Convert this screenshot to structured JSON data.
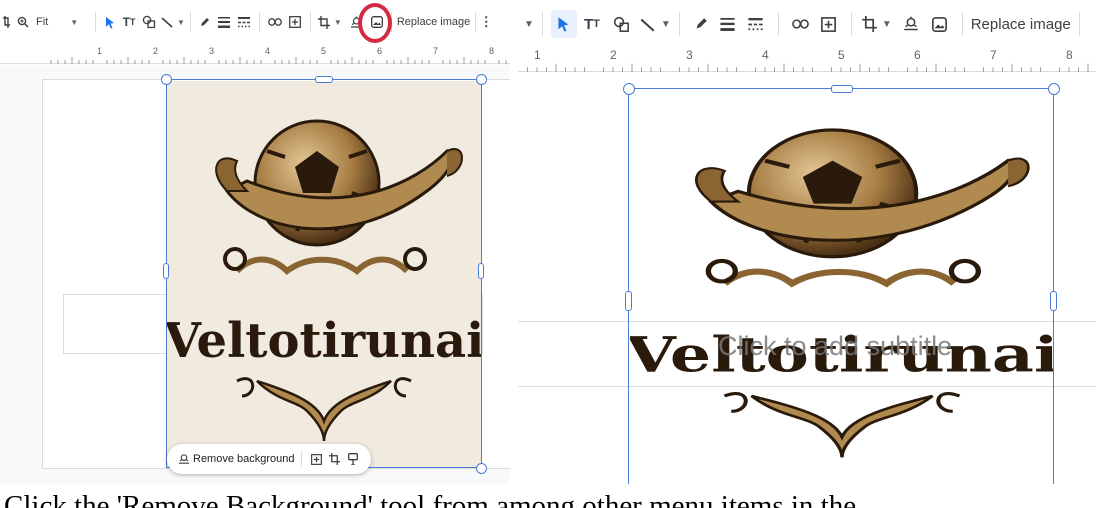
{
  "left_toolbar": {
    "zoom_label": "Fit",
    "replace_image_label": "Replace image"
  },
  "right_toolbar": {
    "replace_image_label": "Replace image"
  },
  "left_ruler": {
    "numbers": [
      "1",
      "2",
      "3",
      "4",
      "5",
      "6",
      "7",
      "8"
    ]
  },
  "right_ruler": {
    "numbers": [
      "1",
      "2",
      "3",
      "4",
      "5",
      "6",
      "7",
      "8"
    ]
  },
  "image": {
    "logo_text": "Veltotirunai"
  },
  "floating_toolbar": {
    "remove_background_label": "Remove background"
  },
  "right_slide": {
    "subtitle_placeholder": "Click to add subtitle"
  },
  "caption": "Click the 'Remove Background' tool from among other menu items in the",
  "colors": {
    "selection": "#4a7bd6",
    "highlight_circle": "#d42b45",
    "image_background": "#f1ebdf",
    "logo_gold": "#b08a4e",
    "logo_dark": "#2a1a0c"
  },
  "icons": [
    "crop-icon",
    "zoom-icon",
    "select-arrow-icon",
    "text-box-icon",
    "shapes-icon",
    "line-icon",
    "pen-icon",
    "border-weight-icon",
    "border-dash-icon",
    "link-icon",
    "insert-comment-icon",
    "remove-background-icon",
    "replace-image-icon",
    "more-vert-icon"
  ]
}
